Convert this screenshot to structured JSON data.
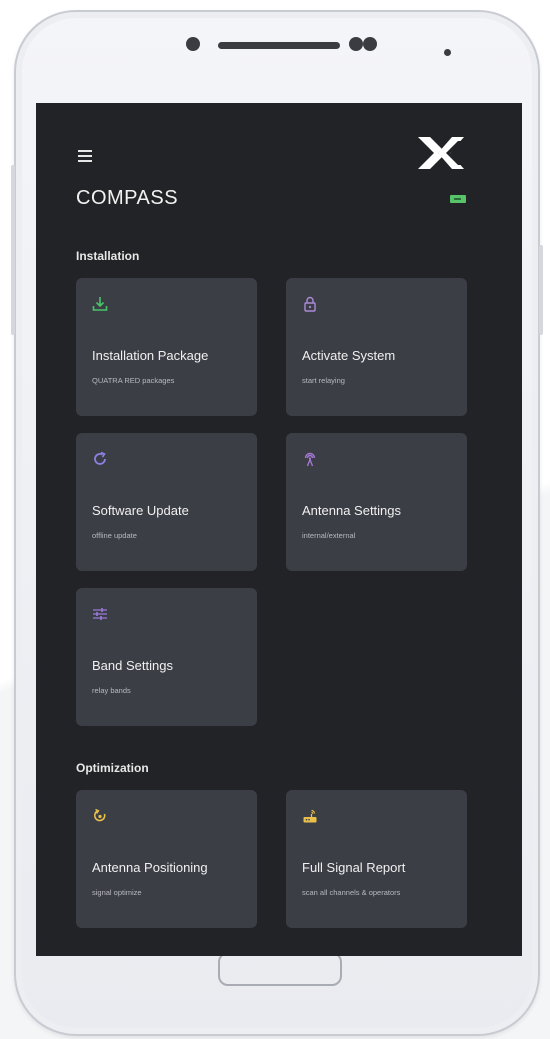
{
  "app": {
    "title": "COMPASS"
  },
  "sections": [
    {
      "title": "Installation"
    },
    {
      "title": "Optimization"
    }
  ],
  "cards": [
    {
      "title": "Installation Package",
      "subtitle": "QUATRA RED packages",
      "icon": "download-icon",
      "color": "#49c46a"
    },
    {
      "title": "Activate System",
      "subtitle": "start relaying",
      "icon": "lock-icon",
      "color": "#a98ad6"
    },
    {
      "title": "Software Update",
      "subtitle": "offline update",
      "icon": "refresh-icon",
      "color": "#8e7fe0"
    },
    {
      "title": "Antenna Settings",
      "subtitle": "internal/external",
      "icon": "antenna-icon",
      "color": "#a67ad8"
    },
    {
      "title": "Band Settings",
      "subtitle": "relay bands",
      "icon": "sliders-icon",
      "color": "#9a7ad8"
    },
    {
      "title": "Antenna Positioning",
      "subtitle": "signal optimize",
      "icon": "compass-target-icon",
      "color": "#e9c04a"
    },
    {
      "title": "Full Signal Report",
      "subtitle": "scan all channels & operators",
      "icon": "router-icon",
      "color": "#e9c04a"
    }
  ],
  "colors": {
    "screen_bg": "#222326",
    "card_bg": "#3c3e46",
    "battery": "#57c46a"
  }
}
